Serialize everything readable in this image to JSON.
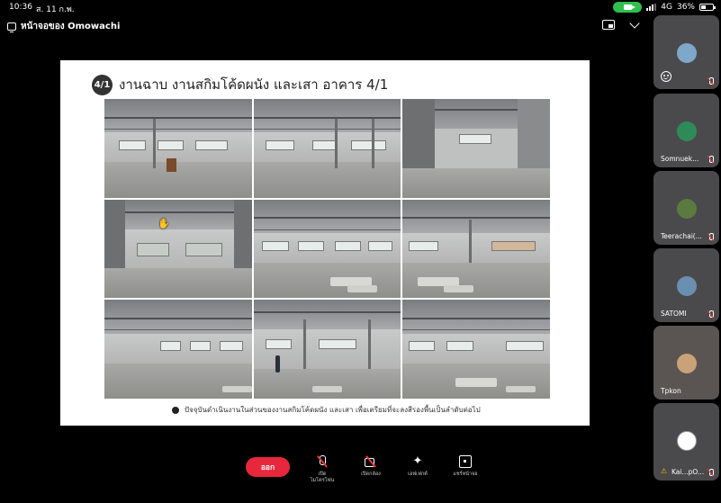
{
  "status_bar": {
    "time": "10:36",
    "date": "ส. 11 ก.พ.",
    "network": "4G",
    "battery": "36%",
    "battery_level": 0.36
  },
  "header": {
    "title": "หน้าจอของ Omowachi"
  },
  "slide": {
    "badge": "4/1",
    "title": "งานฉาบ งานสกิมโค้ดผนัง และเสา อาคาร 4/1",
    "caption": "ปัจจุบันดำเนินงานในส่วนของงานสกิมโค้ดผนัง และเสา เพื่อเตรียมที่จะลงสีรองพื้นเป็นลำดับต่อไป"
  },
  "participants": [
    {
      "name": "",
      "avatar_color": "#7fa7c9"
    },
    {
      "name": "Somnuek...",
      "avatar_color": "#2f8a5a"
    },
    {
      "name": "Teerachai(...",
      "avatar_color": "#5b7a3f"
    },
    {
      "name": "SATOMI",
      "avatar_color": "#6b8fb0"
    },
    {
      "name": "Tpkon",
      "avatar_color": "#c9a27a"
    },
    {
      "name": "Kai...pO...",
      "avatar_color": "#ffffff"
    }
  ],
  "toolbar": {
    "leave": "ออก",
    "mic": "เปิดไมโครโฟน",
    "mic_line1": "เปิด",
    "mic_line2": "ไมโครโฟน",
    "video": "เปิดกล้อง",
    "effects": "เอฟเฟกต์",
    "share": "แชร์หน้าจอ"
  },
  "colors": {
    "leave_button": "#e8273c",
    "camera_pill": "#2fbf4e",
    "mute_slash": "#e8373f"
  }
}
